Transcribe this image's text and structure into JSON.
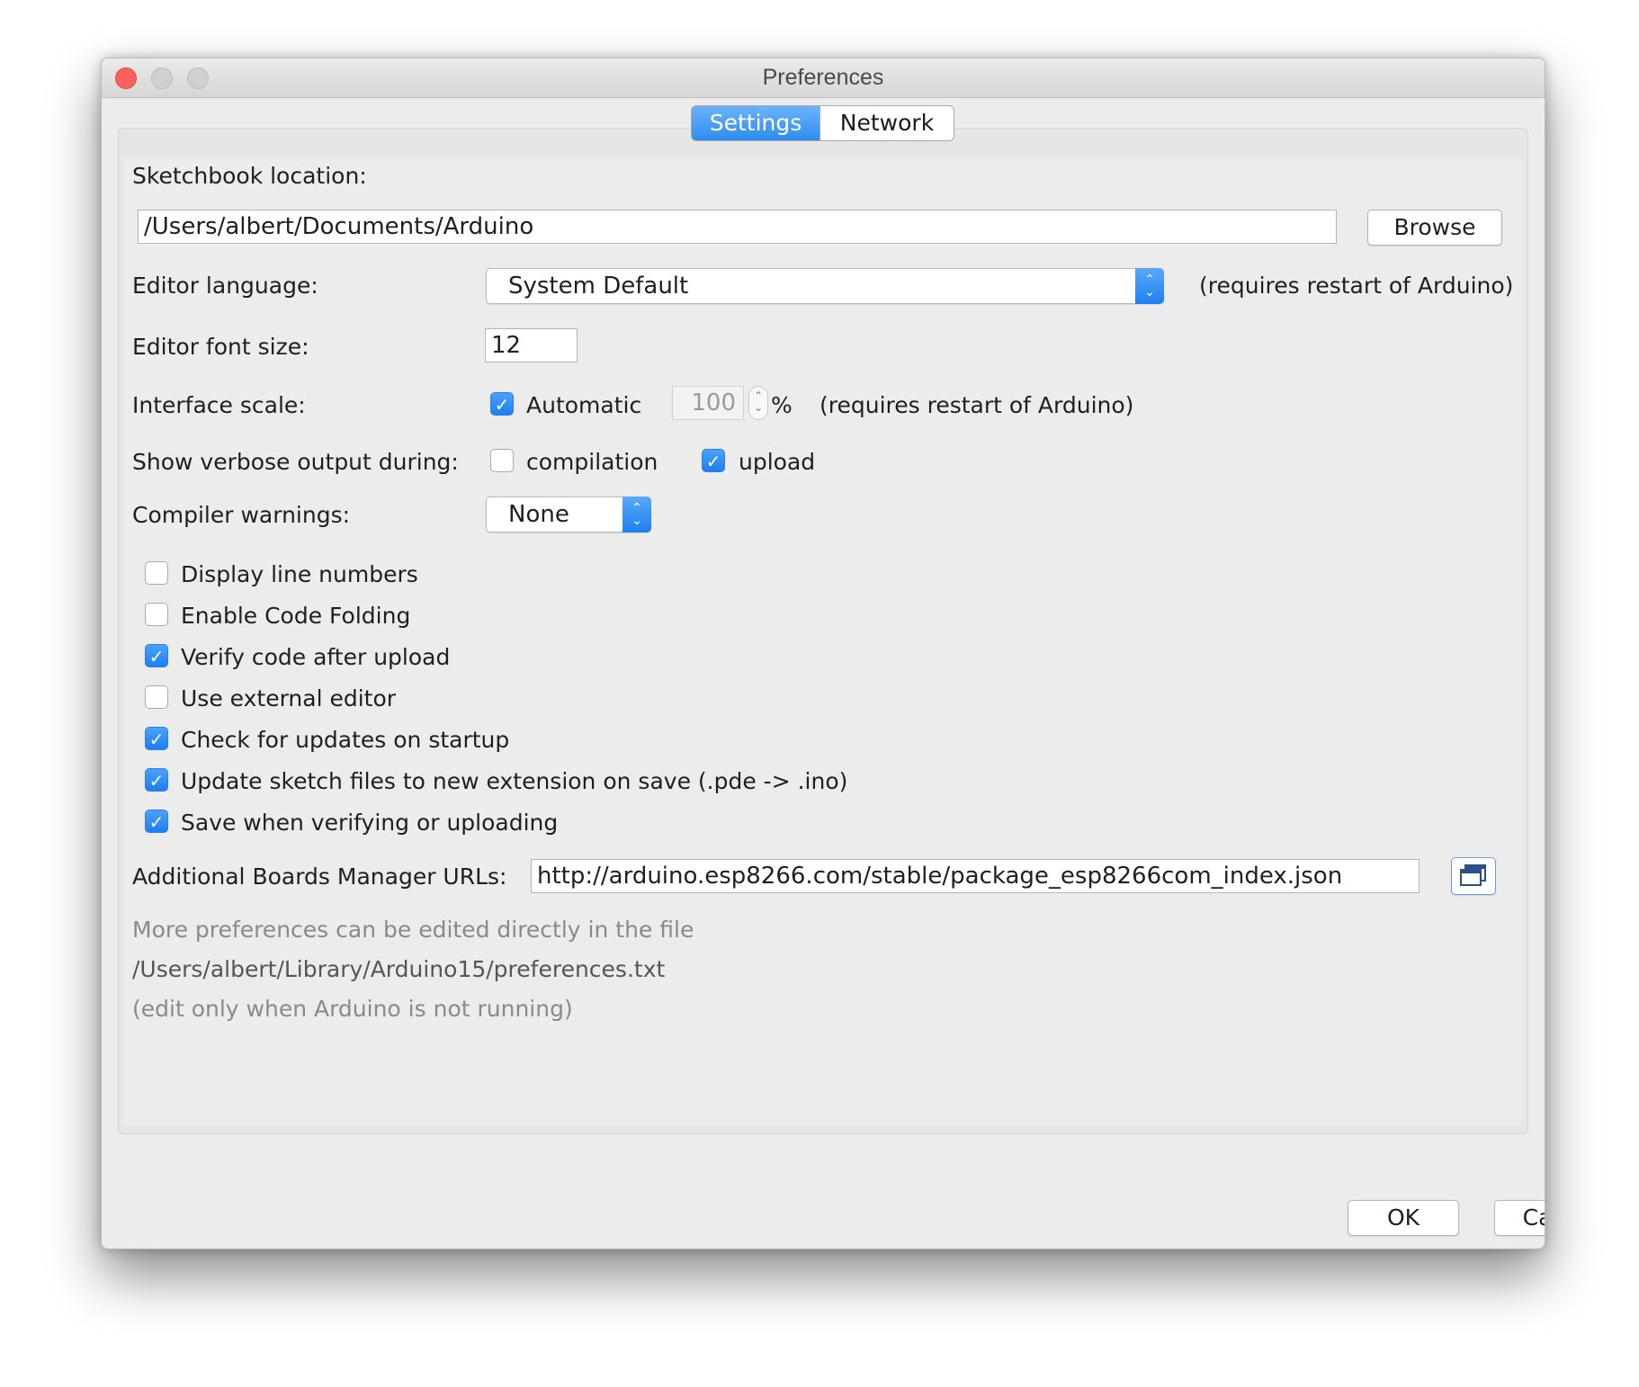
{
  "window": {
    "title": "Preferences"
  },
  "tabs": [
    {
      "label": "Settings",
      "active": true
    },
    {
      "label": "Network",
      "active": false
    }
  ],
  "sketchbook": {
    "label": "Sketchbook location:",
    "path": "/Users/albert/Documents/Arduino",
    "browse_label": "Browse"
  },
  "editor_language": {
    "label": "Editor language:",
    "value": "System Default",
    "note": "(requires restart of Arduino)"
  },
  "font_size": {
    "label": "Editor font size:",
    "value": "12"
  },
  "interface_scale": {
    "label": "Interface scale:",
    "automatic_label": "Automatic",
    "automatic_checked": true,
    "value": "100",
    "unit": "%",
    "note": "(requires restart of Arduino)"
  },
  "verbose": {
    "label": "Show verbose output during:",
    "compilation_label": "compilation",
    "compilation_checked": false,
    "upload_label": "upload",
    "upload_checked": true
  },
  "compiler_warnings": {
    "label": "Compiler warnings:",
    "value": "None"
  },
  "options": [
    {
      "label": "Display line numbers",
      "checked": false
    },
    {
      "label": "Enable Code Folding",
      "checked": false
    },
    {
      "label": "Verify code after upload",
      "checked": true
    },
    {
      "label": "Use external editor",
      "checked": false
    },
    {
      "label": "Check for updates on startup",
      "checked": true
    },
    {
      "label": "Update sketch files to new extension on save (.pde -> .ino)",
      "checked": true
    },
    {
      "label": "Save when verifying or uploading",
      "checked": true
    }
  ],
  "boards_manager": {
    "label": "Additional Boards Manager URLs:",
    "value": "http://arduino.esp8266.com/stable/package_esp8266com_index.json"
  },
  "footer_notes": {
    "line1": "More preferences can be edited directly in the file",
    "line2": "/Users/albert/Library/Arduino15/preferences.txt",
    "line3": "(edit only when Arduino is not running)"
  },
  "buttons": {
    "ok": "OK",
    "cancel": "Cancel"
  },
  "icons": {
    "close": "close-icon",
    "minimize": "minimize-icon",
    "zoom": "zoom-icon",
    "checkmark": "checkmark-icon",
    "stepper": "chevron-up-down-icon",
    "url-list": "window-list-icon"
  },
  "colors": {
    "accent": "#2d8cf0",
    "close": "#fc605b"
  }
}
